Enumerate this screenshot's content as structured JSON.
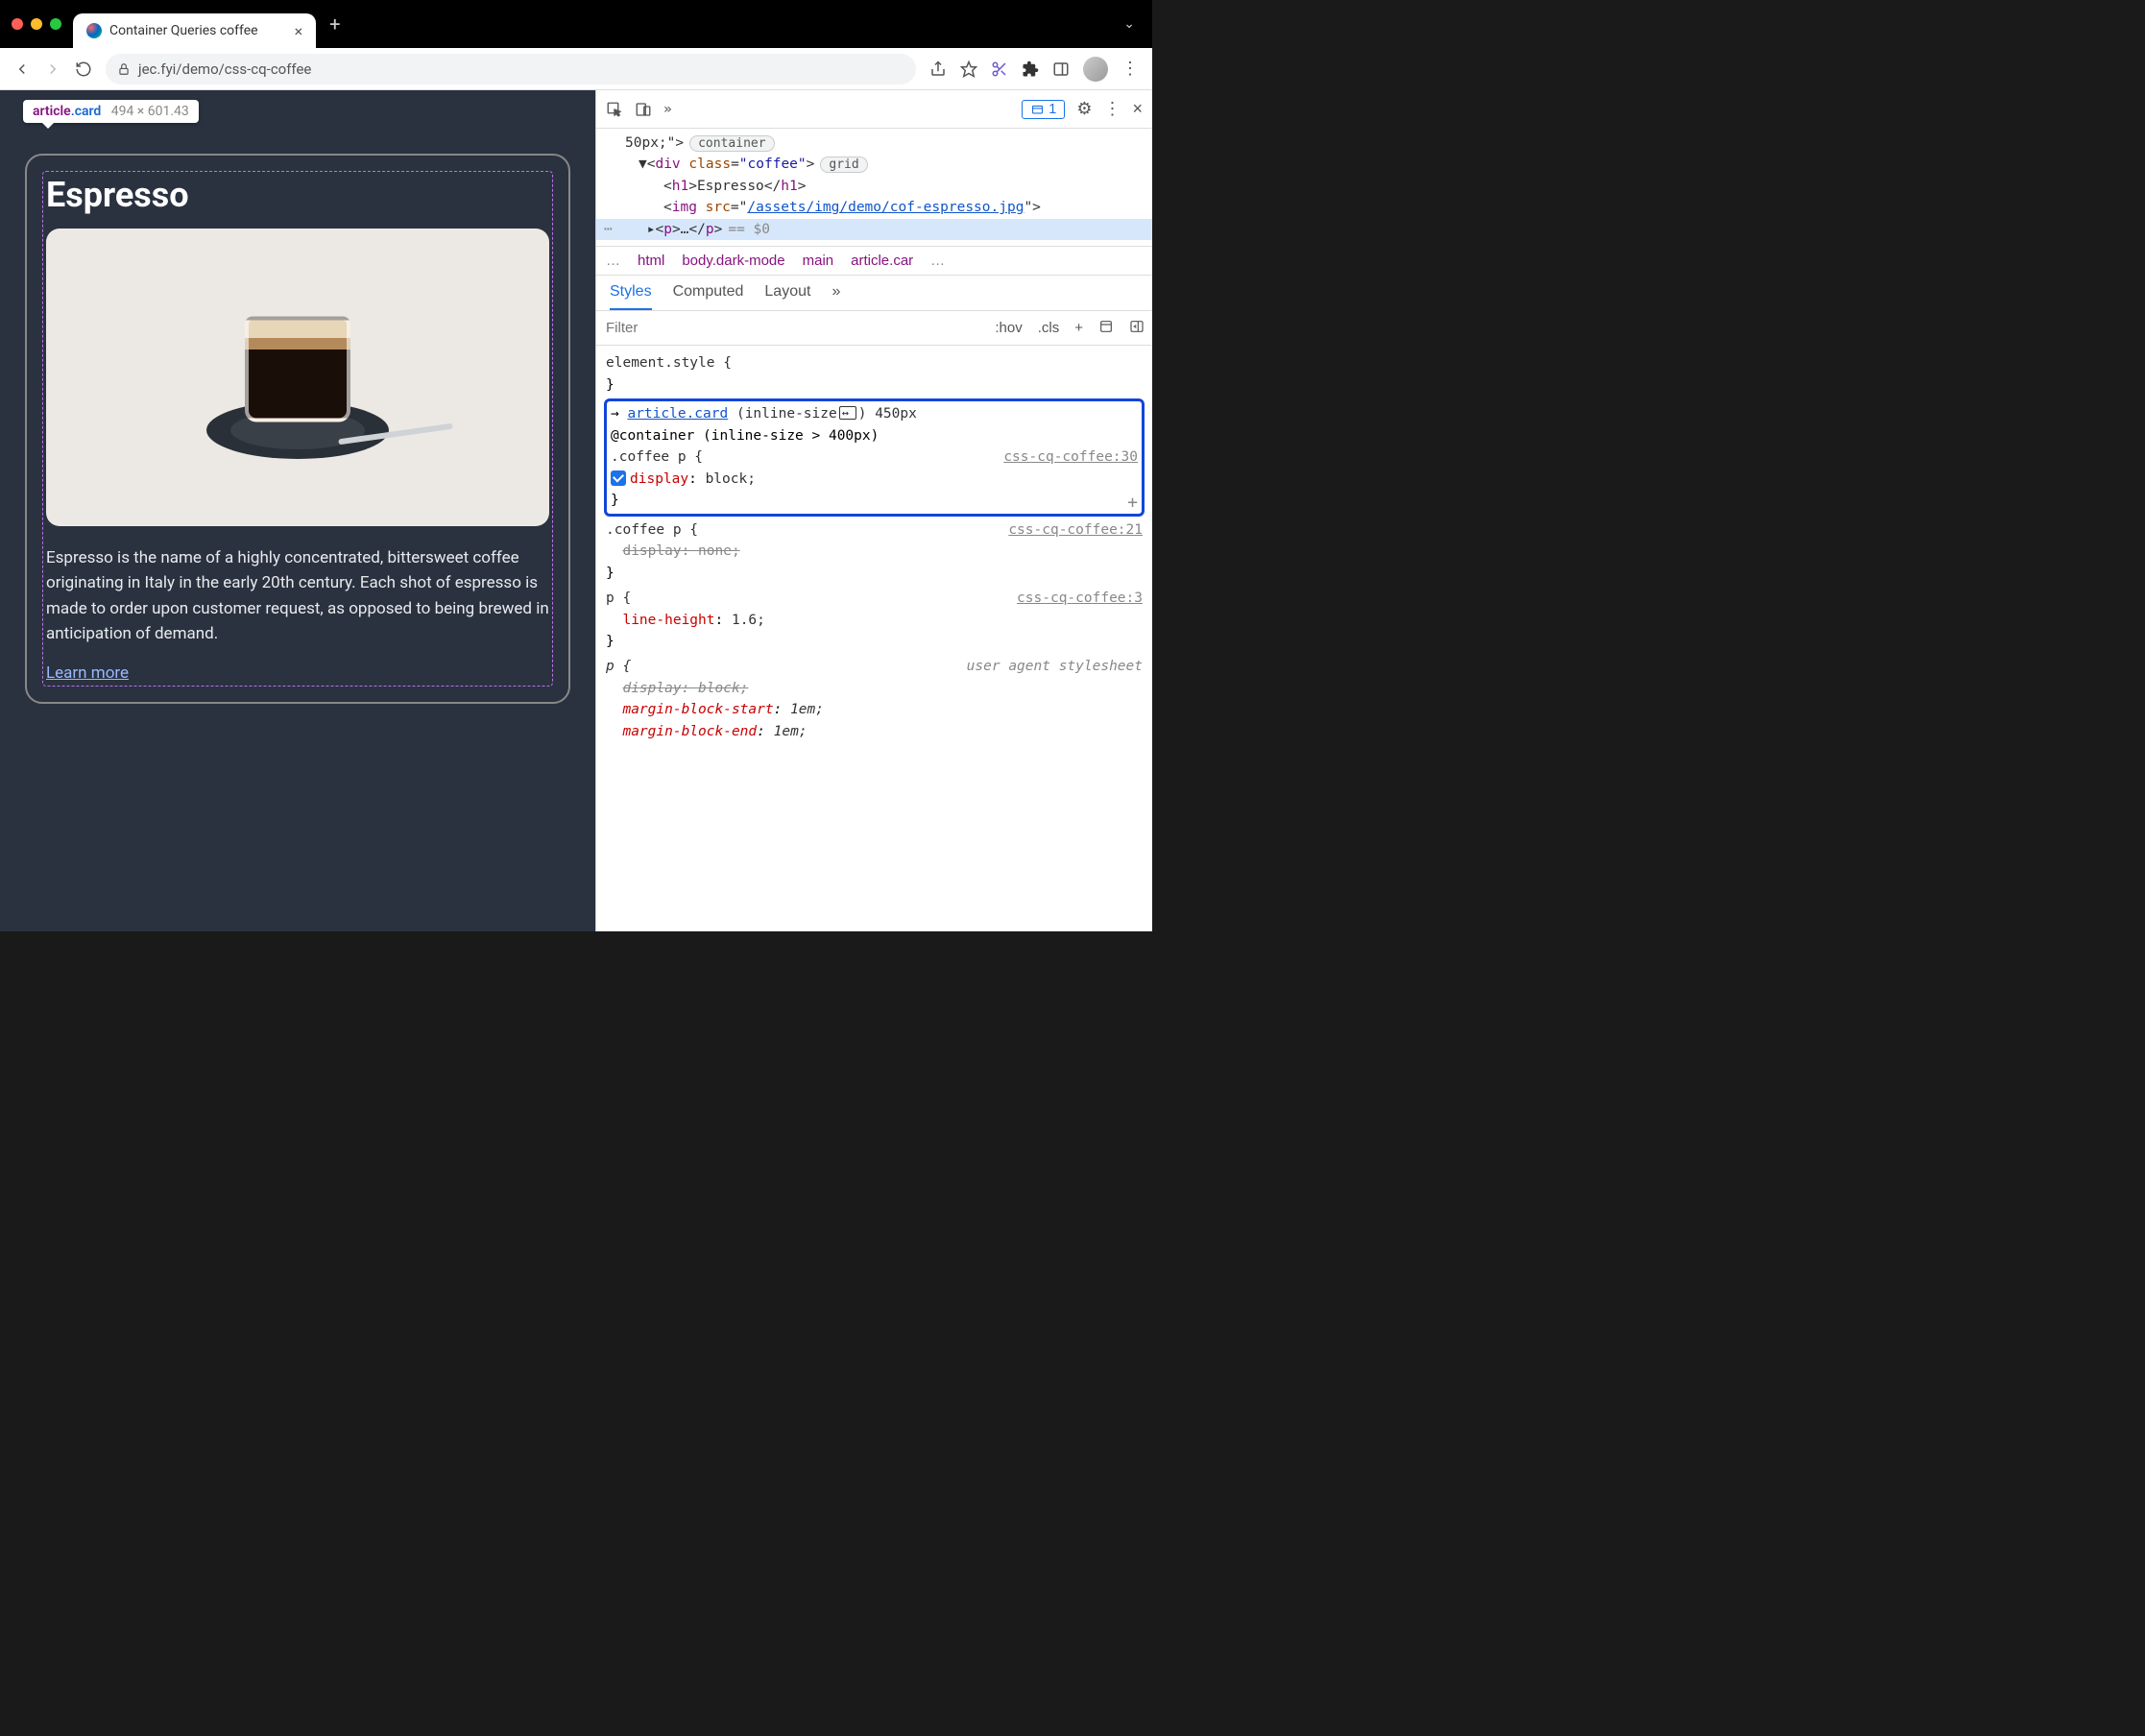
{
  "browser": {
    "tab_title": "Container Queries coffee",
    "url_display": "jec.fyi/demo/css-cq-coffee"
  },
  "inspector_tooltip": {
    "tag": "article",
    "class": ".card",
    "dimensions": "494 × 601.43"
  },
  "page_content": {
    "heading": "Espresso",
    "paragraph": "Espresso is the name of a highly concentrated, bittersweet coffee originating in Italy in the early 20th century. Each shot of espresso is made to order upon customer request, as opposed to being brewed in anticipation of demand.",
    "link_text": "Learn more"
  },
  "devtools": {
    "toolbar": {
      "issues_count": "1"
    },
    "dom": {
      "line0_suffix": "50px;\">",
      "line0_pill": "container",
      "line1_prefix": "<div class=\"coffee\">",
      "line1_pill": "grid",
      "line2": "<h1>Espresso</h1>",
      "line3_pre": "<img src=\"",
      "line3_link": "/assets/img/demo/cof-espresso.jpg",
      "line3_post": "\">",
      "line4_collapsed": "<p>…</p>",
      "line4_eq": "== $0"
    },
    "crumbs": [
      "…",
      "html",
      "body.dark-mode",
      "main",
      "article.car",
      "…"
    ],
    "tabs": {
      "styles": "Styles",
      "computed": "Computed",
      "layout": "Layout"
    },
    "filter": {
      "placeholder": "Filter",
      "hov": ":hov",
      "cls": ".cls"
    },
    "rules": {
      "element_style": "element.style {",
      "highlighted": {
        "container_link": "article.card",
        "container_info": "(inline-size",
        "container_size": ") 450px",
        "at_rule": "@container (inline-size > 400px)",
        "selector": ".coffee p {",
        "source": "css-cq-coffee:30",
        "prop": "display",
        "val": "block;"
      },
      "r2": {
        "selector": ".coffee p {",
        "source": "css-cq-coffee:21",
        "prop": "display",
        "val": "none;"
      },
      "r3": {
        "selector": "p {",
        "source": "css-cq-coffee:3",
        "prop": "line-height",
        "val": "1.6;"
      },
      "r4": {
        "selector": "p {",
        "source": "user agent stylesheet",
        "p1": "display",
        "v1": "block;",
        "p2": "margin-block-start",
        "v2": "1em;",
        "p3": "margin-block-end",
        "v3": "1em;"
      }
    }
  }
}
